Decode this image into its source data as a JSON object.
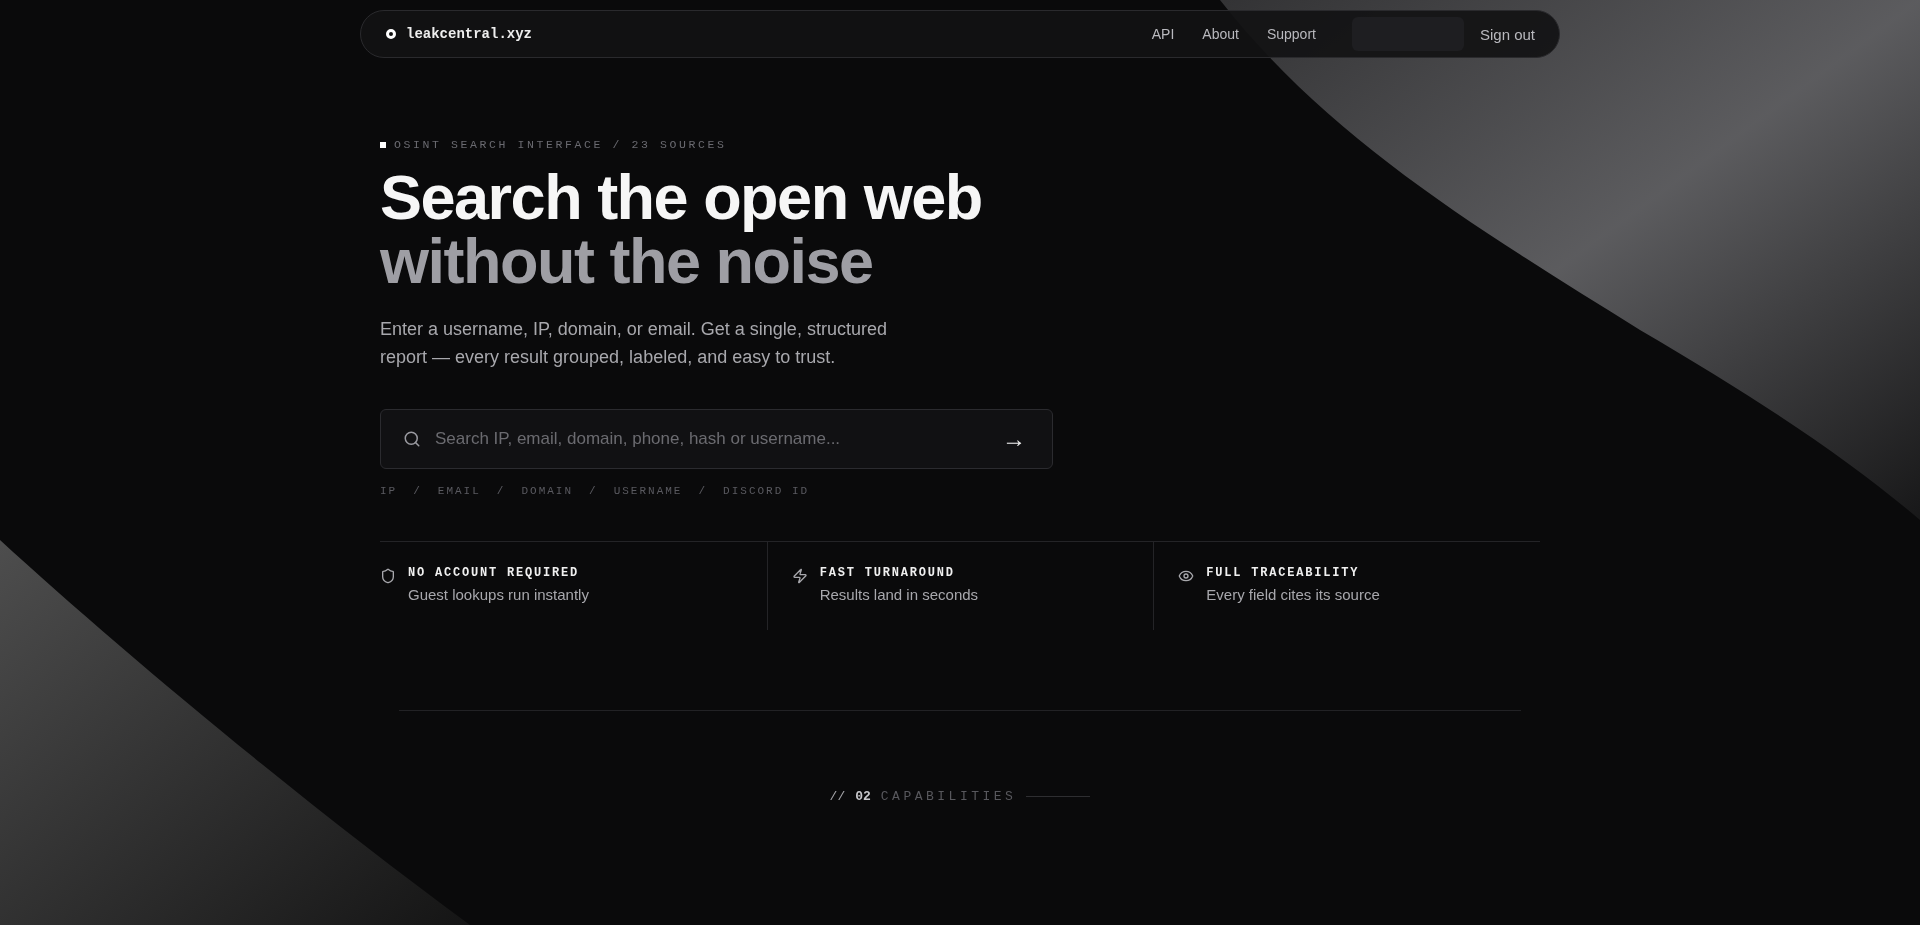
{
  "nav": {
    "brand": "leakcentral.xyz",
    "links": [
      "API",
      "About",
      "Support"
    ],
    "sign_out": "Sign out"
  },
  "hero": {
    "eyebrow": "OSINT SEARCH INTERFACE / 23 SOURCES",
    "title_line_1": "Search the open web",
    "title_line_2": "without the noise",
    "lead": "Enter a username, IP, domain, or email. Get a single, structured report — every result grouped, labeled, and easy to trust."
  },
  "search": {
    "placeholder": "Search IP, email, domain, phone, hash or username...",
    "submit": "→"
  },
  "query_types": [
    "IP",
    "EMAIL",
    "DOMAIN",
    "USERNAME",
    "DISCORD ID"
  ],
  "query_separator": "/",
  "features": [
    {
      "kind": "shield",
      "title": "NO ACCOUNT REQUIRED",
      "text": "Guest lookups run instantly"
    },
    {
      "kind": "bolt",
      "title": "FAST TURNAROUND",
      "text": "Results land in seconds"
    },
    {
      "kind": "eye",
      "title": "FULL TRACEABILITY",
      "text": "Every field cites its source"
    }
  ],
  "section": {
    "prefix": "//",
    "number": "02",
    "title": "CAPABILITIES"
  }
}
